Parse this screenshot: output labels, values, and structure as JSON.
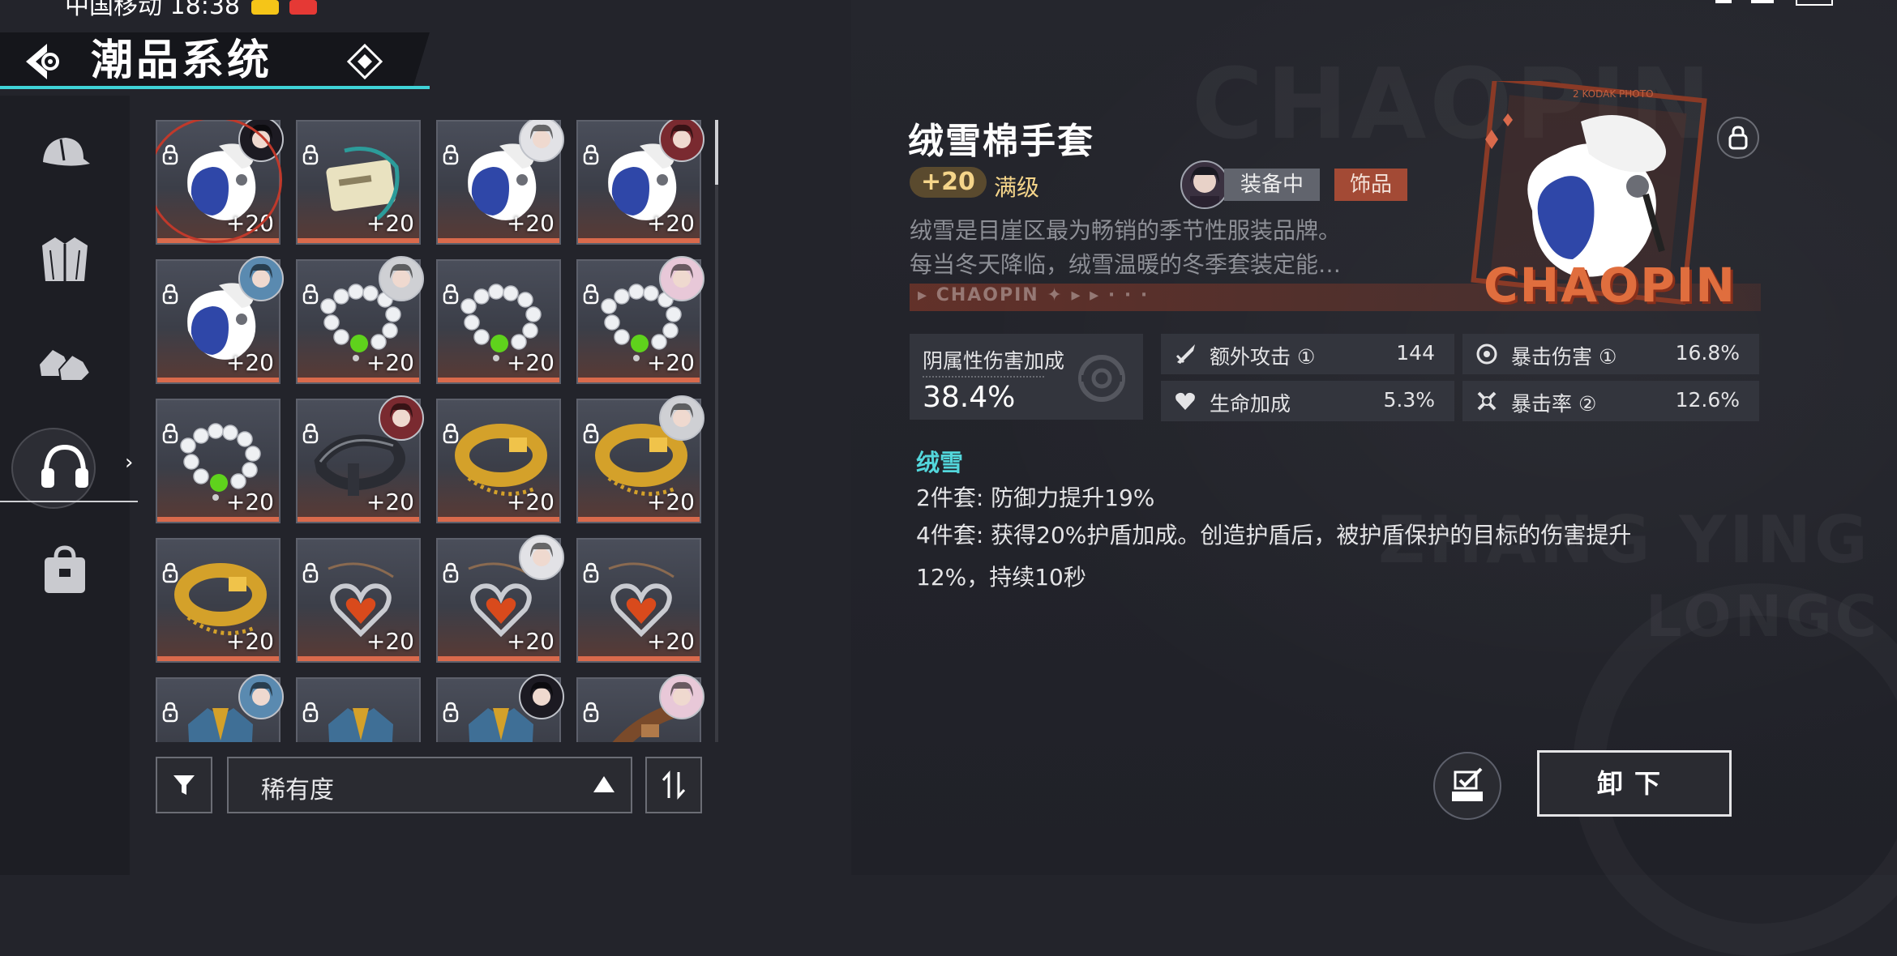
{
  "status_bar": {
    "carrier_time": "中国移动 18:38"
  },
  "header": {
    "title": "潮品系统"
  },
  "nav": {
    "items": [
      {
        "icon": "cap-icon"
      },
      {
        "icon": "jacket-icon"
      },
      {
        "icon": "shoes-icon"
      },
      {
        "icon": "headphones-icon",
        "active": true
      },
      {
        "icon": "bag-icon"
      }
    ]
  },
  "grid": {
    "items": [
      {
        "type": "glove",
        "level": "+20",
        "has_char": true,
        "selected": true
      },
      {
        "type": "card",
        "level": "+20",
        "has_char": false
      },
      {
        "type": "glove",
        "level": "+20",
        "has_char": true
      },
      {
        "type": "glove",
        "level": "+20",
        "has_char": true
      },
      {
        "type": "glove",
        "level": "+20",
        "has_char": true
      },
      {
        "type": "pearls",
        "level": "+20",
        "has_char": true
      },
      {
        "type": "pearls",
        "level": "+20",
        "has_char": false
      },
      {
        "type": "pearls",
        "level": "+20",
        "has_char": true
      },
      {
        "type": "pearls",
        "level": "+20",
        "has_char": false
      },
      {
        "type": "belt-dark",
        "level": "+20",
        "has_char": true
      },
      {
        "type": "belt-gold",
        "level": "+20",
        "has_char": false
      },
      {
        "type": "belt-gold",
        "level": "+20",
        "has_char": true
      },
      {
        "type": "belt-gold",
        "level": "+20",
        "has_char": false
      },
      {
        "type": "heart",
        "level": "+20",
        "has_char": false
      },
      {
        "type": "heart",
        "level": "+20",
        "has_char": true
      },
      {
        "type": "heart",
        "level": "+20",
        "has_char": false
      },
      {
        "type": "jacket",
        "level": "",
        "has_char": true
      },
      {
        "type": "jacket",
        "level": "",
        "has_char": false
      },
      {
        "type": "jacket",
        "level": "",
        "has_char": true
      },
      {
        "type": "strap",
        "level": "",
        "has_char": true
      }
    ]
  },
  "sort": {
    "label": "稀有度"
  },
  "detail": {
    "title": "绒雪棉手套",
    "level": "+20",
    "max_label": "满级",
    "equipped_label": "装备中",
    "type_label": "饰品",
    "description_line1": "绒雪是目崖区最为畅销的季节性服装品牌。",
    "description_line2": "每当冬天降临，绒雪温暖的冬季套装定能…",
    "strip_text": "▸ CHAOPIN ✦ ▸ ▸ · · ·",
    "brand": "CHAOPIN",
    "main_stat": {
      "name": "阴属性伤害加成",
      "value": "38.4%"
    },
    "sub_stats": [
      {
        "icon": "sword-icon",
        "name": "额外攻击 ①",
        "value": "144"
      },
      {
        "icon": "crit-damage-icon",
        "name": "暴击伤害 ①",
        "value": "16.8%"
      },
      {
        "icon": "heart-icon",
        "name": "生命加成",
        "value": "5.3%"
      },
      {
        "icon": "crit-rate-icon",
        "name": "暴击率 ②",
        "value": "12.6%"
      }
    ],
    "set": {
      "name": "绒雪",
      "two_piece": "2件套: 防御力提升19%",
      "four_piece_line1": "4件套: 获得20%护盾加成。创造护盾后，被护盾保护的目标的伤害提升",
      "four_piece_line2": "12%，持续10秒"
    },
    "unequip_label": "卸下"
  },
  "colors": {
    "accent": "#3fd3d8",
    "level_bar": "#d96a4c",
    "type_tag": "#a34a35",
    "set_name": "#53d7dc"
  }
}
